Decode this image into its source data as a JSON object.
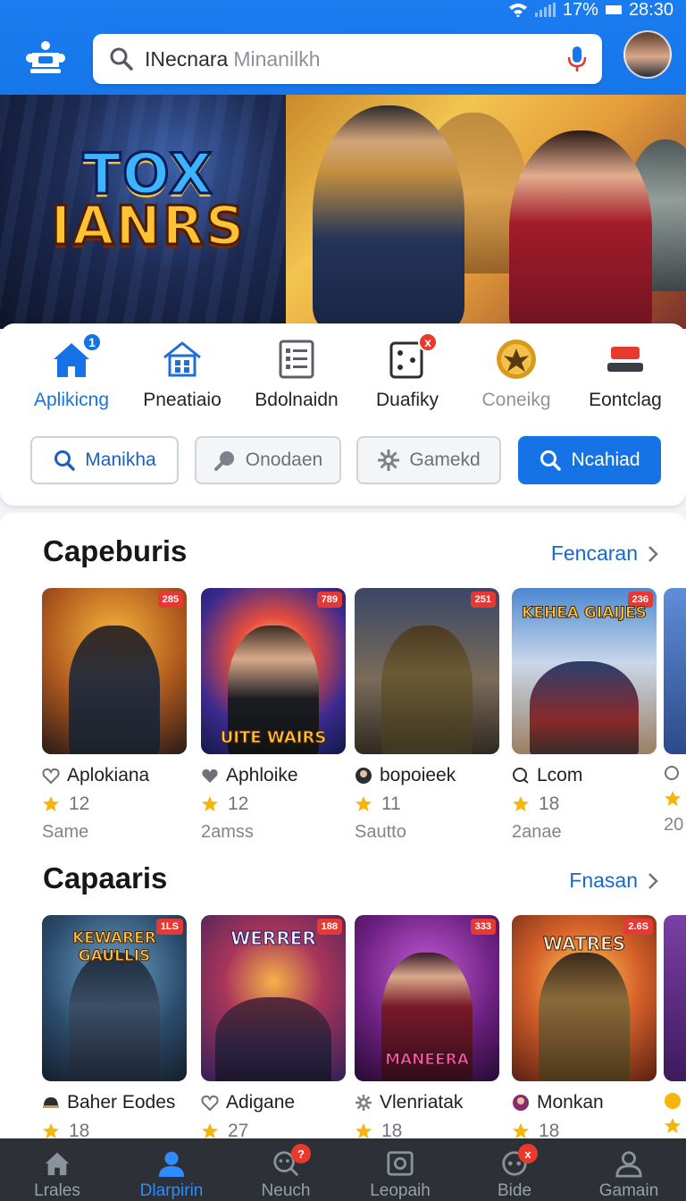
{
  "status": {
    "battery": "17%",
    "time": "28:30"
  },
  "search": {
    "query": "INecnara",
    "placeholder": "Minanilkh"
  },
  "hero": {
    "logo_line1": "TOX",
    "logo_line2": "IANRS"
  },
  "categories": [
    {
      "label": "Aplikicng",
      "icon": "home-icon",
      "badge": "1"
    },
    {
      "label": "Pneatiaio",
      "icon": "house-grid-icon"
    },
    {
      "label": "Bdolnaidn",
      "icon": "list-icon"
    },
    {
      "label": "Duafiky",
      "icon": "dice-icon",
      "badge": "x"
    },
    {
      "label": "Coneikg",
      "icon": "emblem-icon"
    },
    {
      "label": "Eontclag",
      "icon": "flag-icon"
    }
  ],
  "chips": [
    {
      "label": "Manikha",
      "icon": "search-icon"
    },
    {
      "label": "Onodaen",
      "icon": "search-icon"
    },
    {
      "label": "Gamekd",
      "icon": "gear-icon"
    },
    {
      "label": "Ncahiad",
      "icon": "search-icon"
    }
  ],
  "section1": {
    "title": "Capeburis",
    "more": "Fencaran",
    "cards": [
      {
        "tag": "285",
        "name": "Aplokiana",
        "rating": "12",
        "sub": "Same",
        "icon": "heart-icon"
      },
      {
        "tag": "789",
        "name": "Aphloike",
        "rating": "12",
        "sub": "2amss",
        "icon": "heart-icon",
        "overlay": "UITE WAIRS"
      },
      {
        "tag": "251",
        "name": "bopoieek",
        "rating": "11",
        "sub": "Sautto",
        "icon": "avatar-icon"
      },
      {
        "tag": "236",
        "name": "Lcom",
        "rating": "18",
        "sub": "2anae",
        "icon": "chat-icon",
        "overlay": "KEHEA GIAIJES"
      },
      {
        "name": "",
        "rating": "",
        "sub": "20"
      }
    ]
  },
  "section2": {
    "title": "Capaaris",
    "more": "Fnasan",
    "cards": [
      {
        "tag": "1LS",
        "name": "Baher Eodes",
        "rating": "18",
        "icon": "helmet-icon",
        "overlay": "KEWARER GAULLIS"
      },
      {
        "tag": "188",
        "name": "Adigane",
        "rating": "27",
        "icon": "heart-icon",
        "overlay": "WERRER"
      },
      {
        "tag": "333",
        "name": "Vlenriatak",
        "rating": "18",
        "icon": "gear-icon",
        "overlay": "MANEERA"
      },
      {
        "tag": "2.6S",
        "name": "Monkan",
        "rating": "18",
        "icon": "avatar-icon",
        "overlay": "WATRES"
      },
      {
        "name": "",
        "rating": ""
      }
    ]
  },
  "nav": [
    {
      "label": "Lrales",
      "icon": "home-icon"
    },
    {
      "label": "Dlarpirin",
      "icon": "user-icon",
      "active": true
    },
    {
      "label": "Neuch",
      "icon": "search-icon",
      "badge": "?"
    },
    {
      "label": "Leopaih",
      "icon": "camera-icon"
    },
    {
      "label": "Bide",
      "icon": "controller-icon",
      "badge": "x"
    },
    {
      "label": "Gamain",
      "icon": "profile-icon"
    }
  ],
  "colors": {
    "primary": "#1673e6",
    "badge": "#e8392c",
    "nav_bg": "#2d3036"
  }
}
